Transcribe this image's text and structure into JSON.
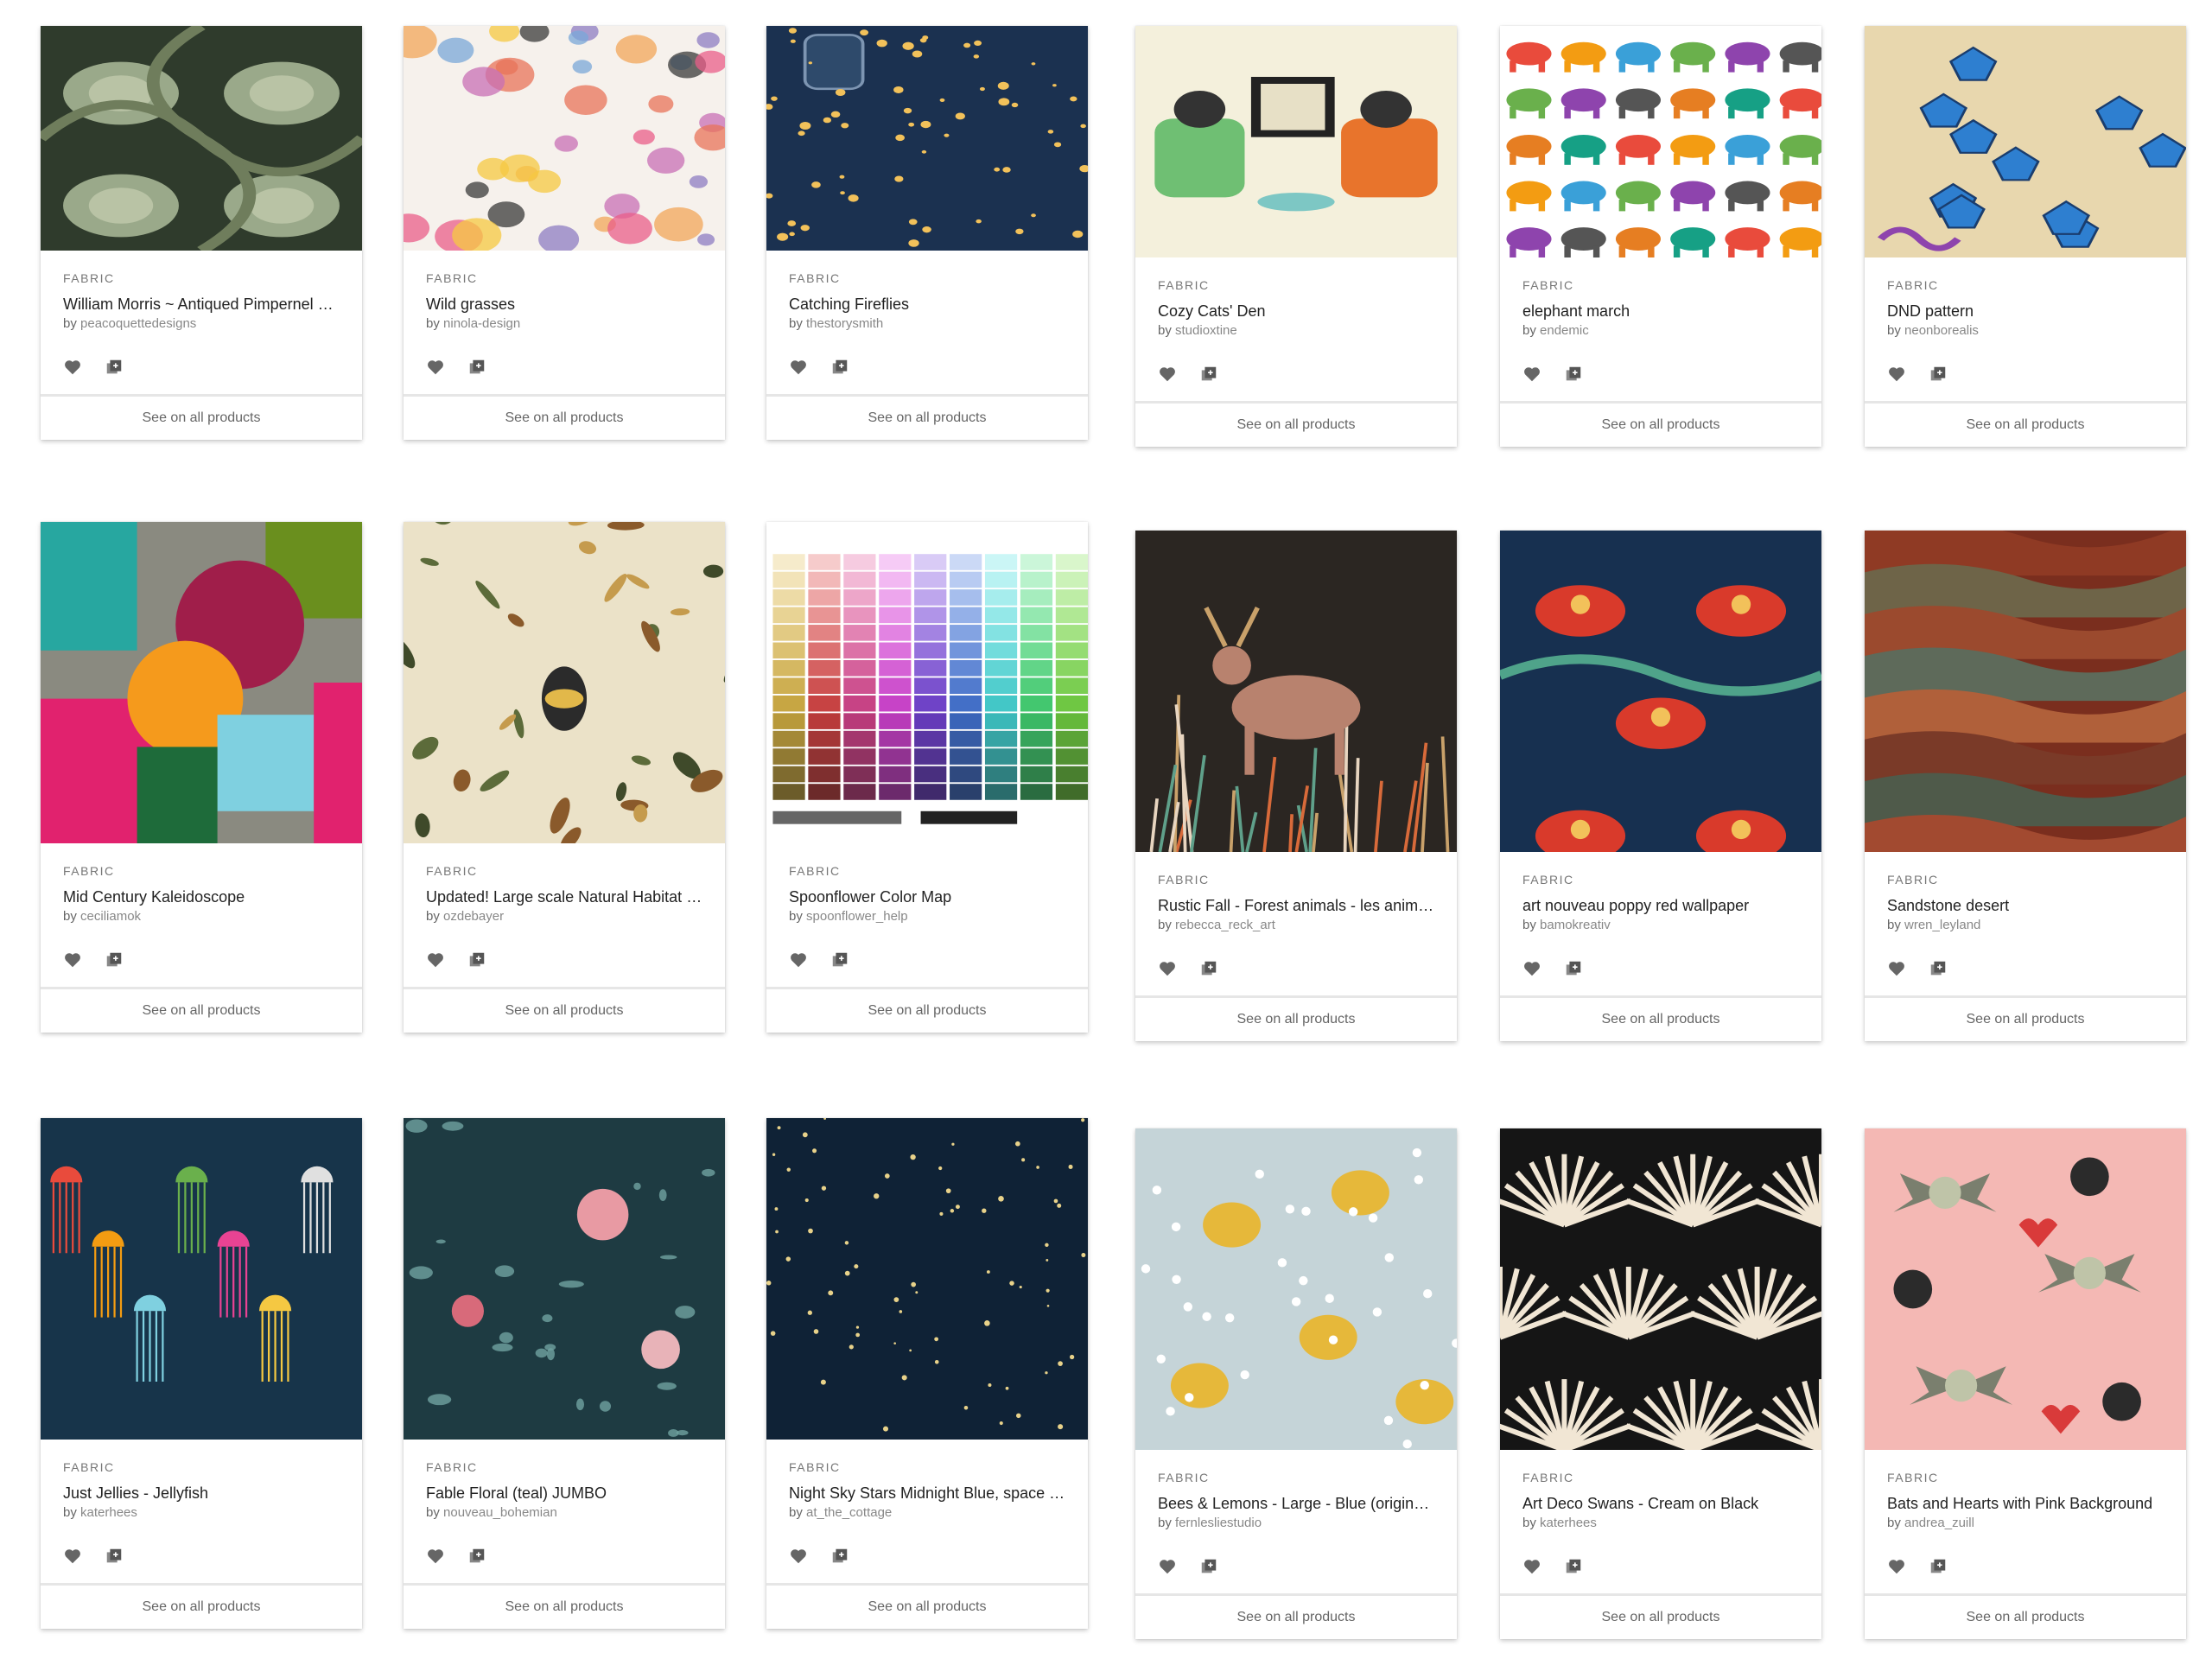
{
  "colors": {
    "card_border": "#e6e6e6",
    "heart": "#666666",
    "text_muted": "#888888"
  },
  "cards": [
    {
      "category": "FABRIC",
      "title": "William Morris ~ Antiqued Pimpernel ~...",
      "by_label": "by",
      "designer": "peacoquettedesigns",
      "see_all": "See on all products",
      "pattern": "pimpernel"
    },
    {
      "category": "FABRIC",
      "title": "Wild grasses",
      "by_label": "by",
      "designer": "ninola-design",
      "see_all": "See on all products",
      "pattern": "wildgrass"
    },
    {
      "category": "FABRIC",
      "title": "Catching Fireflies",
      "by_label": "by",
      "designer": "thestorysmith",
      "see_all": "See on all products",
      "pattern": "fireflies"
    },
    {
      "category": "FABRIC",
      "title": "Cozy Cats' Den",
      "by_label": "by",
      "designer": "studioxtine",
      "see_all": "See on all products",
      "pattern": "cats"
    },
    {
      "category": "FABRIC",
      "title": "elephant march",
      "by_label": "by",
      "designer": "endemic",
      "see_all": "See on all products",
      "pattern": "elephants"
    },
    {
      "category": "FABRIC",
      "title": "DND pattern",
      "by_label": "by",
      "designer": "neonborealis",
      "see_all": "See on all products",
      "pattern": "dnd"
    },
    {
      "category": "FABRIC",
      "title": "Mid Century Kaleidoscope",
      "by_label": "by",
      "designer": "ceciliamok",
      "see_all": "See on all products",
      "pattern": "kaleido"
    },
    {
      "category": "FABRIC",
      "title": "Updated! Large scale Natural Habitat o...",
      "by_label": "by",
      "designer": "ozdebayer",
      "see_all": "See on all products",
      "pattern": "habitat"
    },
    {
      "category": "FABRIC",
      "title": "Spoonflower Color Map",
      "by_label": "by",
      "designer": "spoonflower_help",
      "see_all": "See on all products",
      "pattern": "colormap"
    },
    {
      "category": "FABRIC",
      "title": "Rustic Fall - Forest animals - les animau...",
      "by_label": "by",
      "designer": "rebecca_reck_art",
      "see_all": "See on all products",
      "pattern": "deer"
    },
    {
      "category": "FABRIC",
      "title": "art nouveau poppy red wallpaper",
      "by_label": "by",
      "designer": "bamokreativ",
      "see_all": "See on all products",
      "pattern": "poppy"
    },
    {
      "category": "FABRIC",
      "title": "Sandstone desert",
      "by_label": "by",
      "designer": "wren_leyland",
      "see_all": "See on all products",
      "pattern": "sandstone"
    },
    {
      "category": "FABRIC",
      "title": "Just Jellies - Jellyfish",
      "by_label": "by",
      "designer": "katerhees",
      "see_all": "See on all products",
      "pattern": "jellies"
    },
    {
      "category": "FABRIC",
      "title": "Fable Floral (teal) JUMBO",
      "by_label": "by",
      "designer": "nouveau_bohemian",
      "see_all": "See on all products",
      "pattern": "fable"
    },
    {
      "category": "FABRIC",
      "title": "Night Sky Stars Midnight Blue, space , n...",
      "by_label": "by",
      "designer": "at_the_cottage",
      "see_all": "See on all products",
      "pattern": "nightsky"
    },
    {
      "category": "FABRIC",
      "title": "Bees & Lemons - Large - Blue (original c...",
      "by_label": "by",
      "designer": "fernlesliestudio",
      "see_all": "See on all products",
      "pattern": "lemons"
    },
    {
      "category": "FABRIC",
      "title": "Art Deco Swans - Cream on Black",
      "by_label": "by",
      "designer": "katerhees",
      "see_all": "See on all products",
      "pattern": "swans"
    },
    {
      "category": "FABRIC",
      "title": "Bats and Hearts with Pink Background",
      "by_label": "by",
      "designer": "andrea_zuill",
      "see_all": "See on all products",
      "pattern": "bats"
    }
  ]
}
